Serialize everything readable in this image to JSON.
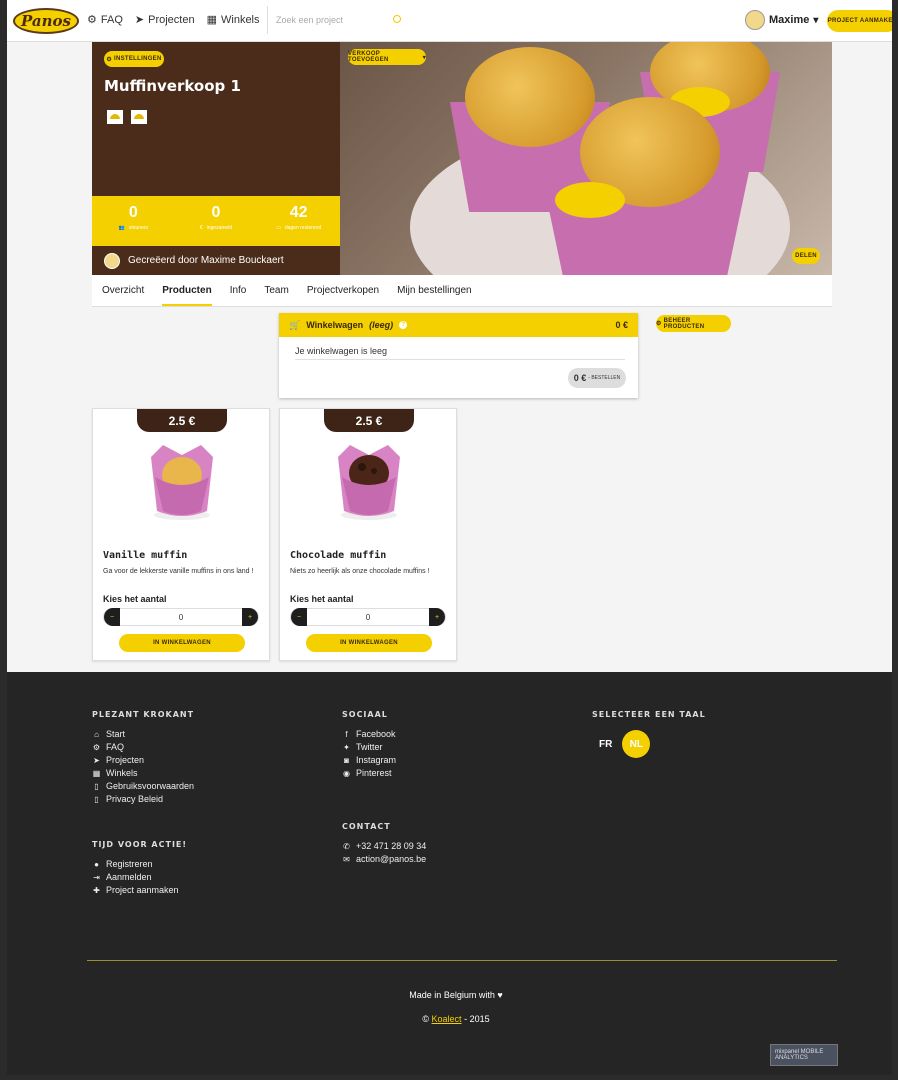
{
  "nav": {
    "logo": "Panos",
    "links": [
      {
        "icon": "cogs-icon",
        "label": "FAQ"
      },
      {
        "icon": "paper-plane-icon",
        "label": "Projecten"
      },
      {
        "icon": "building-icon",
        "label": "Winkels"
      }
    ],
    "search_placeholder": "Zoek een project",
    "user_name": "Maxime",
    "create_button": "PROJECT AANMAKEN"
  },
  "hero": {
    "settings_button": "INSTELLINGEN",
    "title": "Muffinverkoop 1",
    "add_sale_button": "VERKOOP TOEVOEGEN",
    "share_button": "DELEN",
    "stats": [
      {
        "value": "0",
        "label": "steuners",
        "icon": "users-icon"
      },
      {
        "value": "0",
        "label": "ingezameld",
        "icon": "euro-icon"
      },
      {
        "value": "42",
        "label": "dagen resterend",
        "icon": "calendar-icon"
      }
    ],
    "creator": "Gecreëerd door Maxime Bouckaert"
  },
  "tabs": [
    "Overzicht",
    "Producten",
    "Info",
    "Team",
    "Projectverkopen",
    "Mijn bestellingen"
  ],
  "active_tab": "Producten",
  "cart": {
    "title": "Winkelwagen",
    "status": "(leeg)",
    "total": "0 €",
    "empty_text": "Je winkelwagen is leeg",
    "order_amount": "0 €",
    "order_label": "- BESTELLEN"
  },
  "manage_products_button": "BEHEER PRODUCTEN",
  "products": [
    {
      "price": "2.5 €",
      "name": "Vanille muffin",
      "description": "Ga voor de lekkerste vanille muffins in ons land !",
      "qty_label": "Kies het aantal",
      "qty": "0",
      "add_button": "IN WINKELWAGEN",
      "cake_color": "#e8b64a"
    },
    {
      "price": "2.5 €",
      "name": "Chocolade muffin",
      "description": "Niets zo heerlijk als onze chocolade muffins !",
      "qty_label": "Kies het aantal",
      "qty": "0",
      "add_button": "IN WINKELWAGEN",
      "cake_color": "#4a2518"
    }
  ],
  "footer": {
    "col1_title": "PLEZANT KROKANT",
    "col1_items": [
      {
        "icon": "home-icon",
        "label": "Start"
      },
      {
        "icon": "cogs-icon",
        "label": "FAQ"
      },
      {
        "icon": "paper-plane-icon",
        "label": "Projecten"
      },
      {
        "icon": "building-icon",
        "label": "Winkels"
      },
      {
        "icon": "file-icon",
        "label": "Gebruiksvoorwaarden"
      },
      {
        "icon": "file-icon",
        "label": "Privacy Beleid"
      }
    ],
    "col1b_title": "TIJD VOOR ACTIE!",
    "col1b_items": [
      {
        "icon": "user-icon",
        "label": "Registreren"
      },
      {
        "icon": "sign-in-icon",
        "label": "Aanmelden"
      },
      {
        "icon": "plus-icon",
        "label": "Project aanmaken"
      }
    ],
    "col2_title": "SOCIAAL",
    "col2_items": [
      {
        "icon": "facebook-icon",
        "label": "Facebook"
      },
      {
        "icon": "twitter-icon",
        "label": "Twitter"
      },
      {
        "icon": "instagram-icon",
        "label": "Instagram"
      },
      {
        "icon": "pinterest-icon",
        "label": "Pinterest"
      }
    ],
    "col2b_title": "CONTACT",
    "col2b_items": [
      {
        "icon": "phone-icon",
        "label": "+32 471 28 09 34"
      },
      {
        "icon": "envelope-icon",
        "label": "action@panos.be"
      }
    ],
    "col3_title": "SELECTEER EEN TAAL",
    "lang_fr": "FR",
    "lang_nl": "NL",
    "made_in": "Made in Belgium with",
    "copyright_prefix": "©",
    "copyright_link": "Koalect",
    "copyright_suffix": "- 2015",
    "mixpanel": "mixpanel MOBILE ANALYTICS"
  },
  "colors": {
    "accent": "#f5d000",
    "brown": "#4b2c1a",
    "footer": "#252525"
  }
}
